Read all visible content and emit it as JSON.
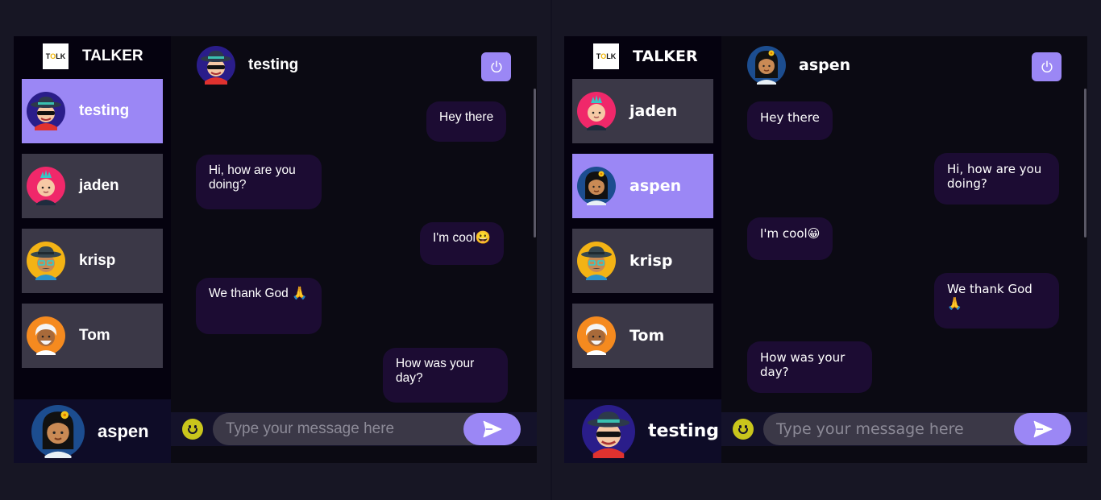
{
  "brand": {
    "logo_text_a": "T",
    "logo_text_o": "O",
    "logo_text_b": "LK",
    "name": "TALKER"
  },
  "colors": {
    "accent": "#9b87f5",
    "contact_bg": "#3b3847",
    "bubble_bg": "#1c0c33",
    "page_bg": "#171624"
  },
  "left": {
    "contacts": [
      {
        "name": "testing",
        "avatar": "avatar-hat-sunglasses-icon",
        "active": true
      },
      {
        "name": "jaden",
        "avatar": "avatar-mohawk-icon",
        "active": false
      },
      {
        "name": "krisp",
        "avatar": "avatar-hat-glasses-icon",
        "active": false
      },
      {
        "name": "Tom",
        "avatar": "avatar-white-hair-icon",
        "active": false
      }
    ],
    "me": {
      "name": "aspen",
      "avatar": "avatar-flower-girl-icon"
    },
    "chat": {
      "title": "testing",
      "messages": [
        {
          "text": "Hey there",
          "side": "right"
        },
        {
          "text": "Hi, how are you doing?",
          "side": "left"
        },
        {
          "text": "I'm cool😀",
          "side": "right"
        },
        {
          "text": "We thank God 🙏",
          "side": "left"
        },
        {
          "text": "How was your day?",
          "side": "right"
        }
      ]
    },
    "composer": {
      "placeholder": "Type your message here"
    }
  },
  "right": {
    "contacts": [
      {
        "name": "jaden",
        "avatar": "avatar-mohawk-icon",
        "active": false
      },
      {
        "name": "aspen",
        "avatar": "avatar-flower-girl-icon",
        "active": true
      },
      {
        "name": "krisp",
        "avatar": "avatar-hat-glasses-icon",
        "active": false
      },
      {
        "name": "Tom",
        "avatar": "avatar-white-hair-icon",
        "active": false
      }
    ],
    "me": {
      "name": "testing",
      "avatar": "avatar-hat-sunglasses-icon"
    },
    "chat": {
      "title": "aspen",
      "messages": [
        {
          "text": "Hey there",
          "side": "left"
        },
        {
          "text": "Hi, how are you doing?",
          "side": "right"
        },
        {
          "text": "I'm cool😀",
          "side": "left"
        },
        {
          "text": "We thank God 🙏",
          "side": "right"
        },
        {
          "text": "How was your day?",
          "side": "left"
        }
      ]
    },
    "composer": {
      "placeholder": "Type your message here"
    }
  }
}
